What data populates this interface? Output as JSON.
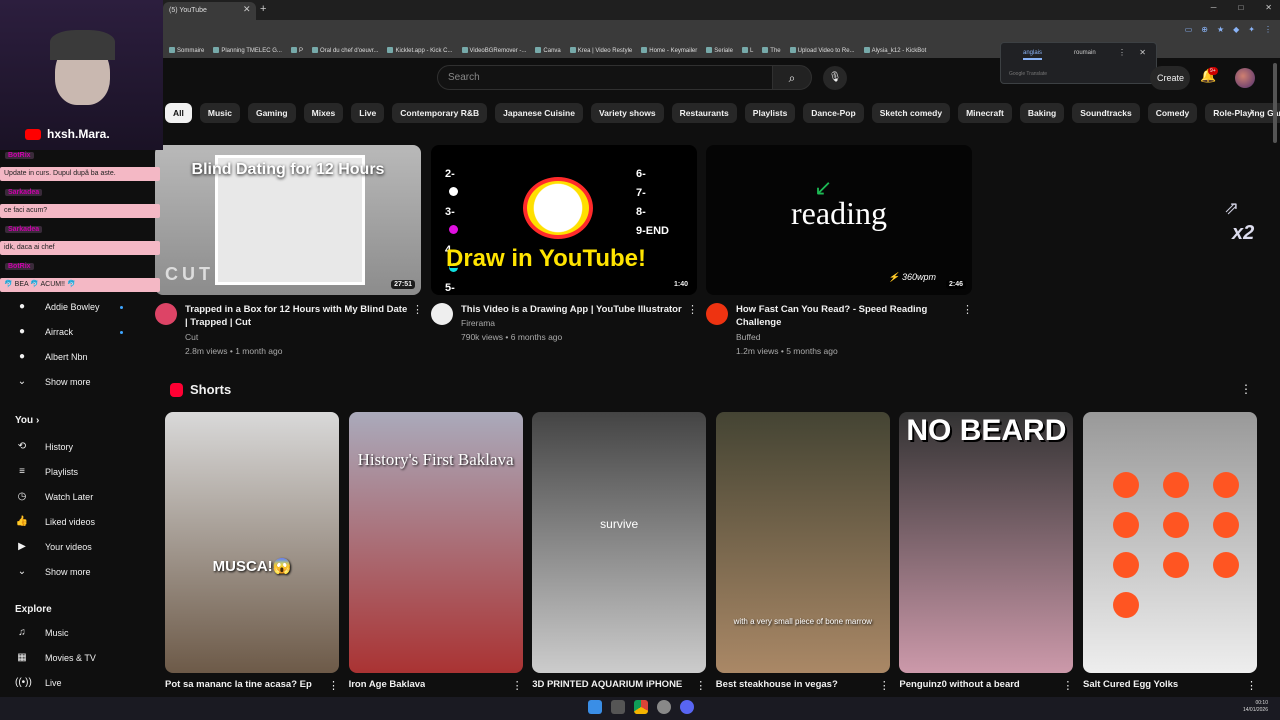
{
  "browser": {
    "tab_title": "(5) YouTube",
    "bookmarks": [
      "Sommaire",
      "Planning TMELEC G...",
      "P",
      "Oral du chef d'oeuvr...",
      "Kicklet.app - Kick C...",
      "VideoBGRemover -...",
      "Canva",
      "Krea | Video Restyle",
      "Home - Keymailer",
      "Seriale",
      "L",
      "The",
      "Upload Video to Re...",
      "Alysia_k12 - KickBot"
    ],
    "translate": {
      "lang_from": "anglais",
      "lang_to": "roumain",
      "footer": "Google Translate"
    }
  },
  "header": {
    "search_placeholder": "Search",
    "create_label": "Create",
    "notif_count": "9+"
  },
  "chips": [
    "All",
    "Music",
    "Gaming",
    "Mixes",
    "Live",
    "Contemporary R&B",
    "Japanese Cuisine",
    "Variety shows",
    "Restaurants",
    "Playlists",
    "Dance-Pop",
    "Sketch comedy",
    "Minecraft",
    "Baking",
    "Soundtracks",
    "Comedy",
    "Role-Playing Games"
  ],
  "videos": [
    {
      "thumb_text": "Blind Dating for 12 Hours",
      "thumb_logo": "CUT",
      "duration": "27:51",
      "title": "Trapped in a Box for 12 Hours with My Blind Date | Trapped | Cut",
      "channel": "Cut",
      "meta": "2.8m views • 1 month ago"
    },
    {
      "thumb_text": "Draw in YouTube!",
      "duration": "1:40",
      "title": "This Video is a Drawing App | YouTube Illustrator",
      "channel": "Firerama",
      "meta": "790k views • 6 months ago",
      "legend_left": [
        "2-",
        "3-",
        "4-",
        "5-"
      ],
      "legend_right": [
        "6-",
        "7-",
        "8-",
        "9-END"
      ]
    },
    {
      "thumb_text": "reading",
      "thumb_wpm": "360wpm",
      "duration": "2:46",
      "title": "How Fast Can You Read? - Speed Reading Challenge",
      "channel": "Buffed",
      "meta": "1.2m views • 5 months ago"
    }
  ],
  "shorts": {
    "section_title": "Shorts",
    "items": [
      {
        "title": "Pot sa mananc la tine acasa? Ep",
        "overlay": "MUSCA!😱"
      },
      {
        "title": "Iron Age Baklava",
        "overlay": "History's First Baklava"
      },
      {
        "title": "3D PRINTED AQUARIUM iPHONE",
        "overlay": "survive"
      },
      {
        "title": "Best steakhouse in vegas?",
        "overlay": "with a very small piece of bone marrow"
      },
      {
        "title": "Penguinz0 without a beard",
        "overlay": "NO BEARD"
      },
      {
        "title": "Salt Cured Egg Yolks",
        "overlay": ""
      }
    ]
  },
  "sidebar": {
    "subs": [
      "Addie Bowley",
      "Airrack",
      "Albert Nbn"
    ],
    "show_more": "Show more",
    "you_title": "You",
    "you_items": [
      "History",
      "Playlists",
      "Watch Later",
      "Liked videos",
      "Your videos",
      "Show more"
    ],
    "explore_title": "Explore",
    "explore_items": [
      "Music",
      "Movies & TV",
      "Live"
    ]
  },
  "stream": {
    "streamer": "hxsh.Mara.",
    "chat": [
      {
        "user": "BotRix",
        "msg": "Update in curs. Dupul după ba aste."
      },
      {
        "user": "Sarkadea",
        "msg": "ce faci acum?"
      },
      {
        "user": "Sarkadea",
        "msg": "idk, daca ai chef"
      },
      {
        "user": "BotRix",
        "msg": "🐬 BEA 🐬 ACUM!! 🐬"
      }
    ]
  },
  "overlay_badge": "x2",
  "clock": {
    "time": "00:10",
    "date": "14/01/2026"
  }
}
